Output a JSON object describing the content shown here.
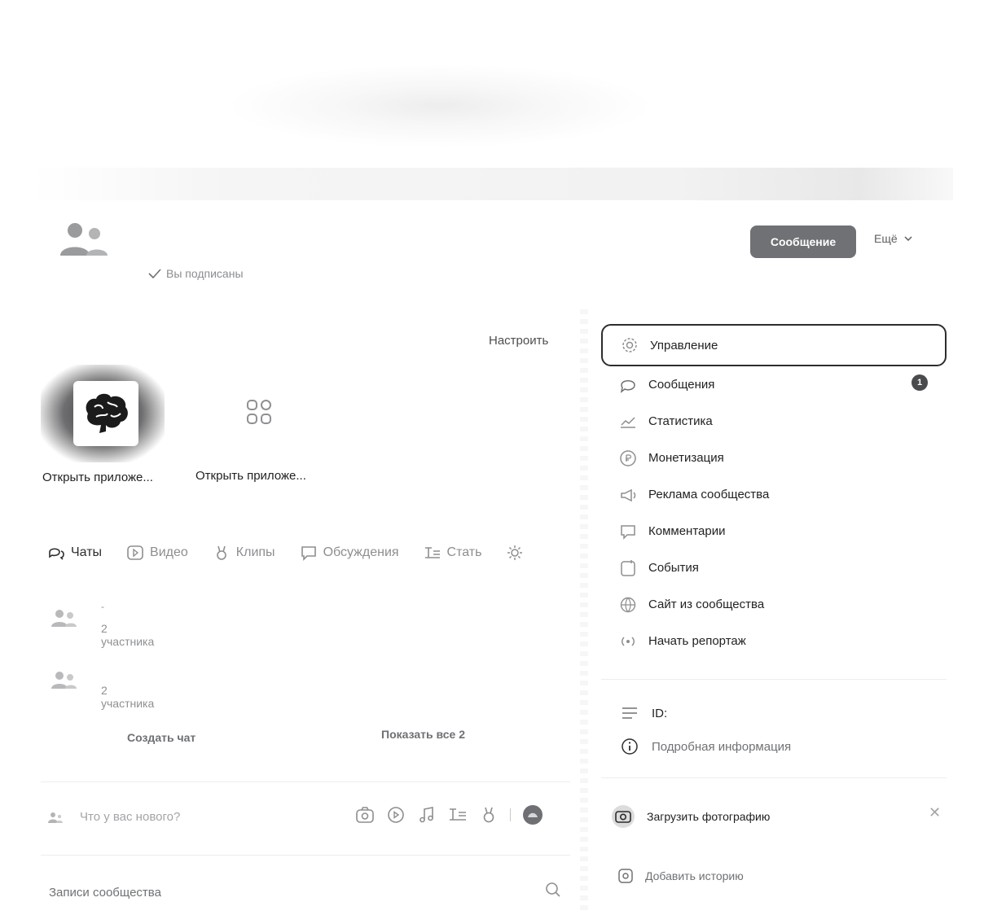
{
  "header": {
    "subscribed_label": "Вы подписаны",
    "message_button": "Сообщение",
    "more_button": "Ещё"
  },
  "apps": {
    "customize_label": "Настроить",
    "items": [
      {
        "label": "Открыть приложе..."
      },
      {
        "label": "Открыть приложе..."
      }
    ]
  },
  "tabs": [
    {
      "label": "Чаты",
      "icon": "chats-icon",
      "active": true
    },
    {
      "label": "Видео",
      "icon": "video-icon"
    },
    {
      "label": "Клипы",
      "icon": "clips-icon"
    },
    {
      "label": "Обсуждения",
      "icon": "discussions-icon"
    },
    {
      "label": "Стать",
      "icon": "articles-icon"
    }
  ],
  "chats": {
    "items": [
      {
        "title": "-",
        "members": "2 участника"
      },
      {
        "members": "2 участника"
      }
    ],
    "create_chat": "Создать чат",
    "show_all": "Показать все 2"
  },
  "composer": {
    "placeholder": "Что у вас нового?"
  },
  "posts": {
    "title": "Записи сообщества"
  },
  "menu": {
    "items": [
      {
        "label": "Управление",
        "icon": "gear-icon",
        "selected": true
      },
      {
        "label": "Сообщения",
        "icon": "message-icon",
        "badge": "1"
      },
      {
        "label": "Статистика",
        "icon": "chart-icon"
      },
      {
        "label": "Монетизация",
        "icon": "coin-icon"
      },
      {
        "label": "Реклама сообщества",
        "icon": "megaphone-icon"
      },
      {
        "label": "Комментарии",
        "icon": "comment-icon"
      },
      {
        "label": "События",
        "icon": "calendar-icon"
      },
      {
        "label": "Сайт из сообщества",
        "icon": "globe-icon"
      },
      {
        "label": "Начать репортаж",
        "icon": "broadcast-icon"
      }
    ]
  },
  "info": {
    "id_label": "ID:",
    "details_label": "Подробная информация"
  },
  "actions": {
    "upload_photo": "Загрузить фотографию",
    "add_story": "Добавить историю"
  },
  "colors": {
    "primary_button": "#6f7174",
    "text": "#2c2d2e",
    "muted": "#8c8e91",
    "badge": "#4a4b4d"
  }
}
